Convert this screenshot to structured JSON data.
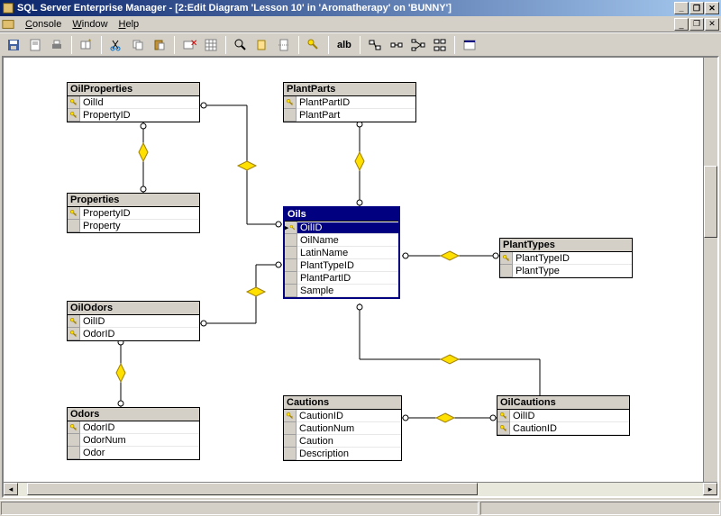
{
  "window": {
    "title": "SQL Server Enterprise Manager - [2:Edit Diagram 'Lesson 10' in 'Aromatherapy' on 'BUNNY']"
  },
  "menu": {
    "console": "Console",
    "window": "Window",
    "help": "Help"
  },
  "toolbar": {
    "ab_label": "alb"
  },
  "entities": {
    "OilProperties": {
      "name": "OilProperties",
      "cols": [
        {
          "k": true,
          "n": "OilId"
        },
        {
          "k": true,
          "n": "PropertyID"
        }
      ]
    },
    "Properties": {
      "name": "Properties",
      "cols": [
        {
          "k": true,
          "n": "PropertyID"
        },
        {
          "k": false,
          "n": "Property"
        }
      ]
    },
    "OilOdors": {
      "name": "OilOdors",
      "cols": [
        {
          "k": true,
          "n": "OilID"
        },
        {
          "k": true,
          "n": "OdorID"
        }
      ]
    },
    "Odors": {
      "name": "Odors",
      "cols": [
        {
          "k": true,
          "n": "OdorID"
        },
        {
          "k": false,
          "n": "OdorNum"
        },
        {
          "k": false,
          "n": "Odor"
        }
      ]
    },
    "PlantParts": {
      "name": "PlantParts",
      "cols": [
        {
          "k": true,
          "n": "PlantPartID"
        },
        {
          "k": false,
          "n": "PlantPart"
        }
      ]
    },
    "Oils": {
      "name": "Oils",
      "cols": [
        {
          "k": true,
          "n": "OilID"
        },
        {
          "k": false,
          "n": "OilName"
        },
        {
          "k": false,
          "n": "LatinName"
        },
        {
          "k": false,
          "n": "PlantTypeID"
        },
        {
          "k": false,
          "n": "PlantPartID"
        },
        {
          "k": false,
          "n": "Sample"
        }
      ]
    },
    "PlantTypes": {
      "name": "PlantTypes",
      "cols": [
        {
          "k": true,
          "n": "PlantTypeID"
        },
        {
          "k": false,
          "n": "PlantType"
        }
      ]
    },
    "Cautions": {
      "name": "Cautions",
      "cols": [
        {
          "k": true,
          "n": "CautionID"
        },
        {
          "k": false,
          "n": "CautionNum"
        },
        {
          "k": false,
          "n": "Caution"
        },
        {
          "k": false,
          "n": "Description"
        }
      ]
    },
    "OilCautions": {
      "name": "OilCautions",
      "cols": [
        {
          "k": true,
          "n": "OilID"
        },
        {
          "k": true,
          "n": "CautionID"
        }
      ]
    }
  }
}
